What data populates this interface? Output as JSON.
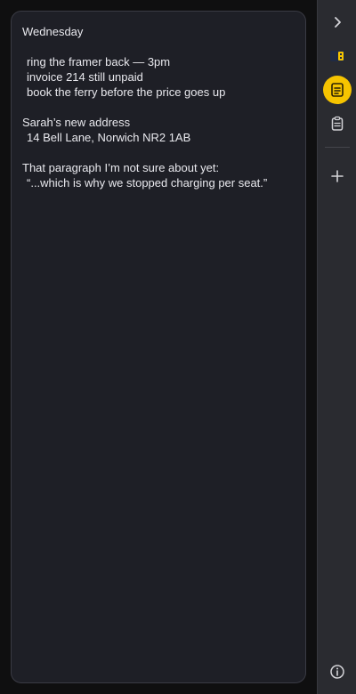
{
  "note": {
    "lines": [
      "Wednesday",
      "",
      "ring the framer back — 3pm",
      "invoice 214 still unpaid",
      "book the ferry before the price goes up",
      "",
      "Sarah’s new address",
      "14 Bell Lane, Norwich NR2 1AB",
      "",
      "That paragraph I’m not sure about yet:",
      "“...which is why we stopped charging per seat.”"
    ]
  },
  "sidebar": {
    "items": [
      {
        "icon": "chevron-right-icon"
      },
      {
        "icon": "panel-layout-icon"
      },
      {
        "icon": "note-icon",
        "active": true
      },
      {
        "icon": "clipboard-icon"
      },
      {
        "icon": "plus-icon"
      },
      {
        "icon": "info-icon"
      }
    ]
  },
  "colors": {
    "accent": "#f6c400",
    "card_bg": "#1e1f26",
    "sidebar_bg": "#2a2b30",
    "text": "#e9e9ee"
  }
}
